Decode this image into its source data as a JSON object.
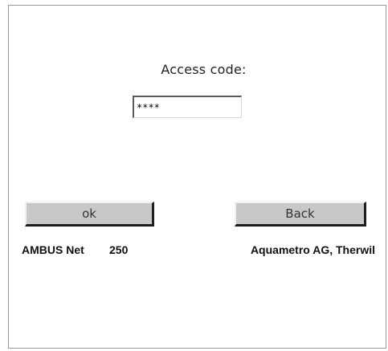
{
  "access": {
    "label": "Access code:",
    "value": "****"
  },
  "buttons": {
    "ok_label": "ok",
    "back_label": "Back"
  },
  "footer": {
    "product_name": "AMBUS Net",
    "product_number": "250",
    "company": "Aquametro AG, Therwil"
  }
}
